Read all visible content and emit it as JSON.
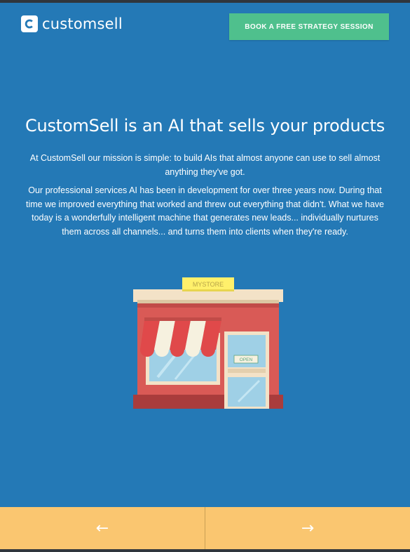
{
  "header": {
    "logo_text": "customsell",
    "cta_label": "BOOK A FREE STRATEGY SESSION"
  },
  "hero": {
    "title": "CustomSell is an AI that sells your products",
    "paragraphs": [
      "At CustomSell our mission is simple: to build AIs that almost anyone can use to sell almost anything they've got.",
      "Our professional services AI has been in development for over three years now. During that time we improved everything that worked and threw out everything that didn't. What we have today is a wonderfully intelligent machine that generates new leads... individually nurtures them across all channels... and turns them into clients when they're ready."
    ]
  },
  "illustration": {
    "sign_text": "MYSTORE",
    "door_sign_text": "OPEN"
  },
  "nav": {
    "prev_icon": "←",
    "next_icon": "→"
  },
  "colors": {
    "background": "#2479b6",
    "cta": "#4fc08d",
    "nav": "#fac670",
    "store_wall": "#d95a56",
    "awning_red": "#e0494a",
    "awning_white": "#f6f1df",
    "sign": "#fff06b"
  }
}
